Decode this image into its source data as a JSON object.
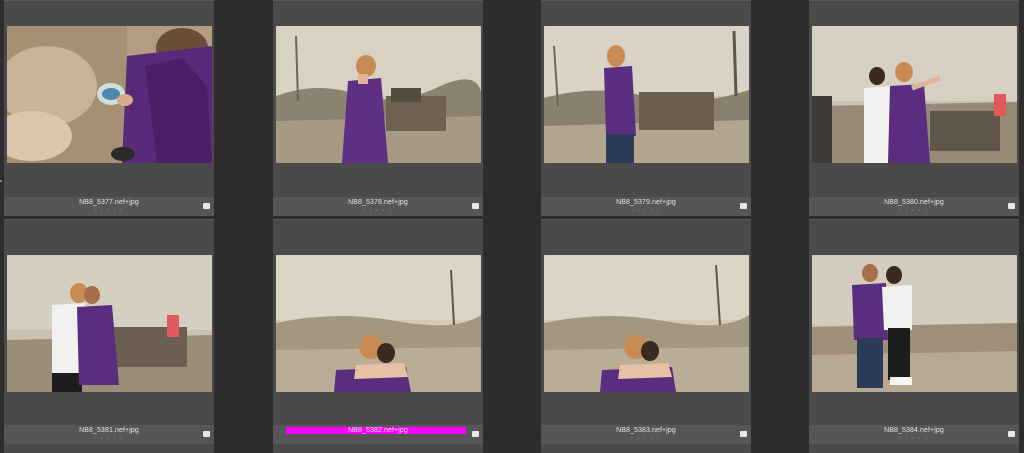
{
  "grid": {
    "cells": [
      {
        "filename": "NB8_5377.nef+jpg",
        "rating_dots": "• • • • •",
        "color_label": ""
      },
      {
        "filename": "NB8_5378.nef+jpg",
        "rating_dots": "• • • • •",
        "color_label": ""
      },
      {
        "filename": "NB8_5379.nef+jpg",
        "rating_dots": "• • • • •",
        "color_label": ""
      },
      {
        "filename": "NB8_5380.nef+jpg",
        "rating_dots": "• • • • •",
        "color_label": ""
      },
      {
        "filename": "NB8_5381.nef+jpg",
        "rating_dots": "• • • • •",
        "color_label": ""
      },
      {
        "filename": "NB8_5382.nef+jpg",
        "rating_dots": "• • • • •",
        "color_label": "#ff00ff"
      },
      {
        "filename": "NB8_5383.nef+jpg",
        "rating_dots": "• • • • •",
        "color_label": ""
      },
      {
        "filename": "NB8_5384.nef+jpg",
        "rating_dots": "• • • • •",
        "color_label": ""
      }
    ]
  },
  "colors": {
    "background": "#2d2d2d",
    "cell": "#4a4a4a",
    "caption": "#565656",
    "magenta_label": "#ff00ff"
  }
}
